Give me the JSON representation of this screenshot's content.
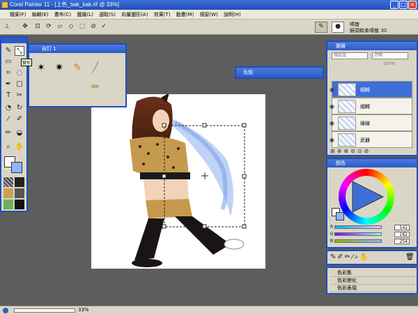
{
  "window": {
    "title": "Corel Painter 11 - [上色_bak_bak.rif @ 33%]"
  },
  "menu": [
    "檔案(F)",
    "編輯(E)",
    "畫布(C)",
    "圖層(L)",
    "選取(S)",
    "向量圖形(A)",
    "效果(T)",
    "動畫(M)",
    "視窗(W)",
    "說明(H)"
  ],
  "propbar": {
    "brush_name": "噴槍",
    "variant": "鏡頭軟柔噴槍 30"
  },
  "toolbox": {
    "tooltip": "變形"
  },
  "custom_palette": {
    "title": "自訂 1"
  },
  "colorset": {
    "title": "色頻"
  },
  "layers": {
    "title": "圖層",
    "blend_mode": "預設值",
    "composite": "忽略",
    "opacity": "100%",
    "items": [
      {
        "name": "細轉",
        "selected": true
      },
      {
        "name": "細轉",
        "selected": false
      },
      {
        "name": "綠線",
        "selected": false
      },
      {
        "name": "武器",
        "selected": false
      }
    ]
  },
  "colors": {
    "title": "顏色",
    "r_label": "R",
    "g_label": "G",
    "b_label": "B",
    "r": "142",
    "g": "182",
    "b": "254",
    "current_color": "#8eb6fe"
  },
  "misc_palettes": [
    "色彩集",
    "色彩變化",
    "色彩表現"
  ],
  "status": {
    "zoom": "33%"
  }
}
